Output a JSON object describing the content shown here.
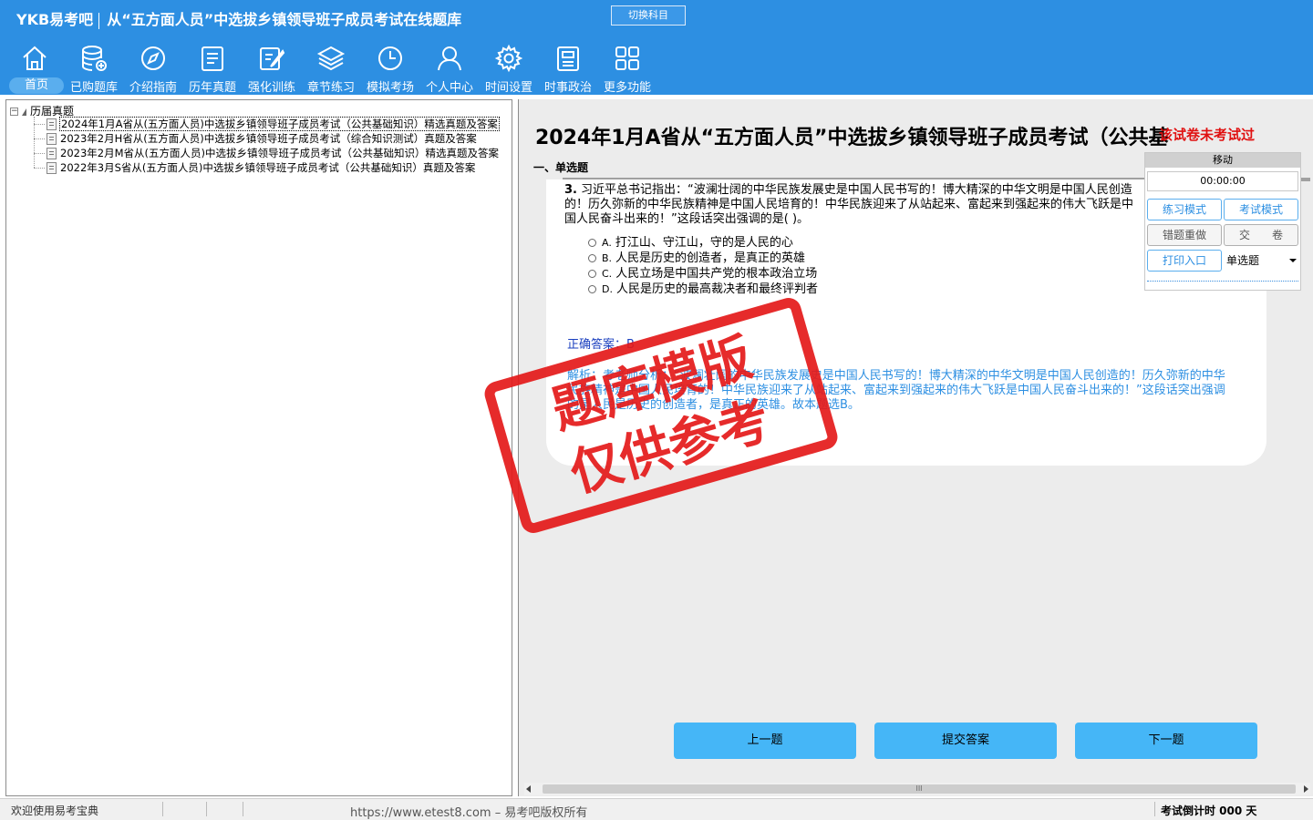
{
  "app": {
    "brand": "YKB易考吧",
    "title": "从“五方面人员”中选拔乡镇领导班子成员考试在线题库",
    "switch_subject": "切换科目"
  },
  "nav": [
    {
      "label": "首页",
      "icon": "home-icon"
    },
    {
      "label": "已购题库",
      "icon": "database-icon"
    },
    {
      "label": "介绍指南",
      "icon": "compass-icon"
    },
    {
      "label": "历年真题",
      "icon": "document-list-icon"
    },
    {
      "label": "强化训练",
      "icon": "edit-icon"
    },
    {
      "label": "章节练习",
      "icon": "layers-icon"
    },
    {
      "label": "模拟考场",
      "icon": "clock-icon"
    },
    {
      "label": "个人中心",
      "icon": "user-icon"
    },
    {
      "label": "时间设置",
      "icon": "gear-icon"
    },
    {
      "label": "时事政治",
      "icon": "newspaper-icon"
    },
    {
      "label": "更多功能",
      "icon": "grid-icon"
    }
  ],
  "tree": {
    "root": "历届真题",
    "items": [
      "2024年1月A省从(五方面人员)中选拔乡镇领导班子成员考试（公共基础知识）精选真题及答案",
      "2023年2月H省从(五方面人员)中选拔乡镇领导班子成员考试（综合知识测试）真题及答案",
      "2023年2月M省从(五方面人员)中选拔乡镇领导班子成员考试（公共基础知识）精选真题及答案",
      "2022年3月S省从(五方面人员)中选拔乡镇领导班子成员考试（公共基础知识）真题及答案"
    ]
  },
  "exam": {
    "title": "2024年1月A省从“五方面人员”中选拔乡镇领导班子成员考试（公共基",
    "warning": "该试卷未考试过",
    "section": "一、单选题",
    "question_number": "3.",
    "question_text": "习近平总书记指出：“波澜壮阔的中华民族发展史是中国人民书写的！博大精深的中华文明是中国人民创造的！历久弥新的中华民族精神是中国人民培育的！中华民族迎来了从站起来、富起来到强起来的伟大飞跃是中国人民奋斗出来的！”这段话突出强调的是(  )。",
    "options": [
      {
        "letter": "A.",
        "text": "打江山、守江山，守的是人民的心"
      },
      {
        "letter": "B.",
        "text": "人民是历史的创造者，是真正的英雄"
      },
      {
        "letter": "C.",
        "text": "人民立场是中国共产党的根本政治立场"
      },
      {
        "letter": "D.",
        "text": "人民是历史的最高裁决者和最终评判者"
      }
    ],
    "answer": "正确答案：B",
    "analysis": "解析：考老师分析：“波澜壮阔的中华民族发展史是中国人民书写的！博大精深的中华文明是中国人民创造的！历久弥新的中华民族精神是中国人民培育的！中华民族迎来了从站起来、富起来到强起来的伟大飞跃是中国人民奋斗出来的！”这段话突出强调的是人民是历史的创造者，是真正的英雄。故本题选B。"
  },
  "controls": {
    "move": "移动",
    "timer": "00:00:00",
    "practice_mode": "练习模式",
    "exam_mode": "考试模式",
    "redo_wrong": "错题重做",
    "submit_paper": "交　　卷",
    "print": "打印入口",
    "type_select": "单选题"
  },
  "buttons": {
    "prev": "上一题",
    "submit": "提交答案",
    "next": "下一题"
  },
  "scroll_grip": "III",
  "stamp": {
    "line1": "题库模版",
    "line2": "仅供参考"
  },
  "status": {
    "left": "欢迎使用易考宝典",
    "mid": "https://www.etest8.com – 易考吧版权所有",
    "right": "考试倒计时 000 天"
  }
}
